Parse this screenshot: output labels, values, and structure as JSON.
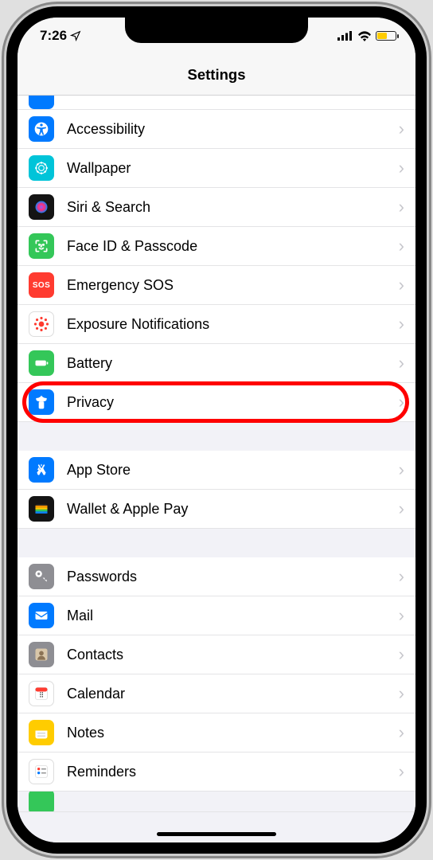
{
  "status": {
    "time": "7:26",
    "location_arrow": "➤"
  },
  "header": {
    "title": "Settings"
  },
  "groups": [
    {
      "items": [
        {
          "id": "accessibility",
          "label": "Accessibility",
          "icon": "accessibility-icon",
          "bg": "bg-blue"
        },
        {
          "id": "wallpaper",
          "label": "Wallpaper",
          "icon": "wallpaper-icon",
          "bg": "bg-teal"
        },
        {
          "id": "siri",
          "label": "Siri & Search",
          "icon": "siri-icon",
          "bg": "bg-black"
        },
        {
          "id": "faceid",
          "label": "Face ID & Passcode",
          "icon": "faceid-icon",
          "bg": "bg-green"
        },
        {
          "id": "sos",
          "label": "Emergency SOS",
          "icon": "sos-icon",
          "bg": "bg-red"
        },
        {
          "id": "exposure",
          "label": "Exposure Notifications",
          "icon": "exposure-icon",
          "bg": "bg-white"
        },
        {
          "id": "battery",
          "label": "Battery",
          "icon": "battery-icon",
          "bg": "bg-green"
        },
        {
          "id": "privacy",
          "label": "Privacy",
          "icon": "privacy-icon",
          "bg": "bg-blue",
          "highlight": true
        }
      ]
    },
    {
      "items": [
        {
          "id": "appstore",
          "label": "App Store",
          "icon": "appstore-icon",
          "bg": "bg-blue"
        },
        {
          "id": "wallet",
          "label": "Wallet & Apple Pay",
          "icon": "wallet-icon",
          "bg": "bg-black"
        }
      ]
    },
    {
      "items": [
        {
          "id": "passwords",
          "label": "Passwords",
          "icon": "passwords-icon",
          "bg": "bg-gray"
        },
        {
          "id": "mail",
          "label": "Mail",
          "icon": "mail-icon",
          "bg": "bg-blue"
        },
        {
          "id": "contacts",
          "label": "Contacts",
          "icon": "contacts-icon",
          "bg": "bg-gray"
        },
        {
          "id": "calendar",
          "label": "Calendar",
          "icon": "calendar-icon",
          "bg": "bg-white"
        },
        {
          "id": "notes",
          "label": "Notes",
          "icon": "notes-icon",
          "bg": "bg-yellow"
        },
        {
          "id": "reminders",
          "label": "Reminders",
          "icon": "reminders-icon",
          "bg": "bg-white"
        }
      ]
    }
  ],
  "icon_text": {
    "sos": "SOS"
  }
}
